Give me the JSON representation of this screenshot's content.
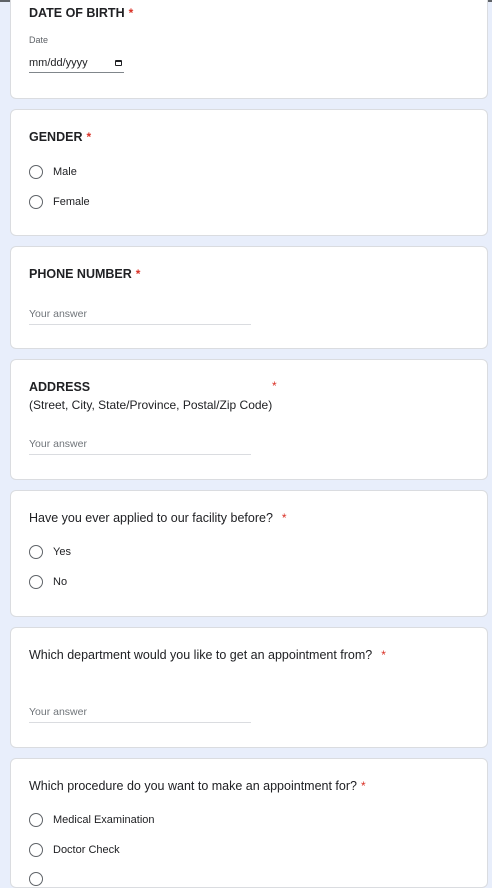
{
  "form": {
    "required_marker": "*",
    "dob": {
      "title": "DATE OF BIRTH",
      "date_label": "Date",
      "date_placeholder": "mm/dd/yyyy"
    },
    "gender": {
      "title": "GENDER",
      "options": [
        "Male",
        "Female"
      ]
    },
    "phone": {
      "title": "PHONE NUMBER",
      "placeholder": "Your answer"
    },
    "address": {
      "title": "ADDRESS",
      "subtitle": "(Street, City, State/Province, Postal/Zip Code)",
      "placeholder": "Your answer"
    },
    "applied_before": {
      "title": "Have you ever applied to our facility before?",
      "options": [
        "Yes",
        "No"
      ]
    },
    "department": {
      "title": "Which department would you like to get an appointment from?",
      "placeholder": "Your answer"
    },
    "procedure": {
      "title": "Which procedure do you want to make an appointment for?",
      "options": [
        "Medical Examination",
        "Doctor Check"
      ]
    }
  },
  "colors": {
    "background": "#e8eefb",
    "card": "#ffffff",
    "required": "#d93025"
  }
}
